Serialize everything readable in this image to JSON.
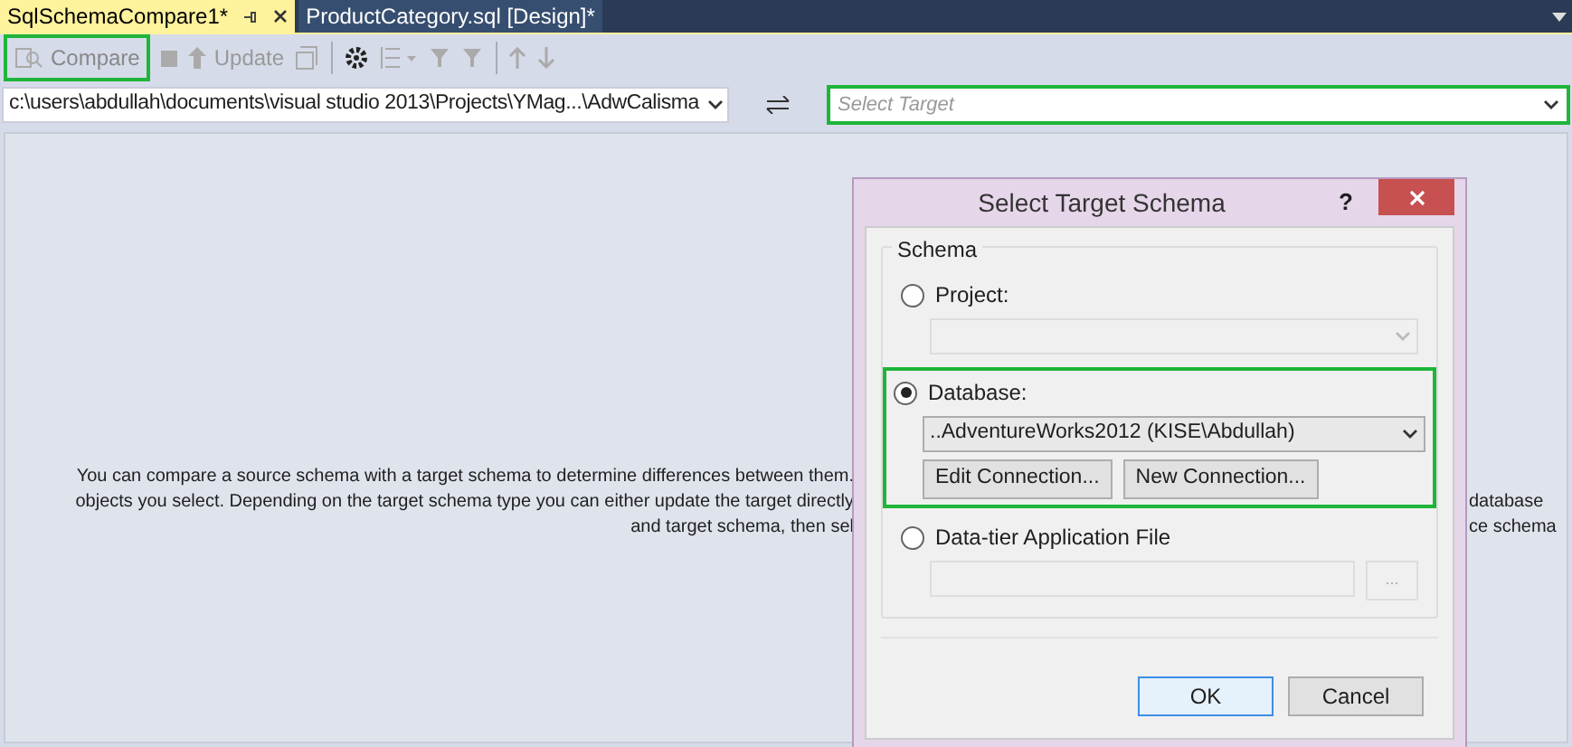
{
  "tabs": [
    {
      "label": "SqlSchemaCompare1*",
      "selected": true
    },
    {
      "label": "ProductCategory.sql [Design]*",
      "selected": false
    }
  ],
  "toolbar": {
    "compare": {
      "label": "Compare",
      "highlighted": true
    },
    "update": {
      "label": "Update"
    }
  },
  "source": {
    "value": "c:\\users\\abdullah\\documents\\visual studio 2013\\Projects\\YMag...\\AdwCalisma"
  },
  "target": {
    "placeholder": "Select Target",
    "highlighted": true
  },
  "message": {
    "left_lines": [
      "You can compare a source schema with a target schema to determine differences between them.",
      "objects you select.  Depending on the target schema type you can either update the target directly",
      "and target schema, then sel"
    ],
    "right_lines": [
      "database",
      "ce schema"
    ]
  },
  "dialog": {
    "title": "Select Target Schema",
    "help": "?",
    "group_label": "Schema",
    "options": [
      {
        "kind": "combo",
        "label": "Project:",
        "selected": false
      },
      {
        "kind": "combo",
        "label": "Database:",
        "selected": true,
        "value": "..AdventureWorks2012 (KISE\\Abdullah)",
        "highlighted": true,
        "buttons": [
          "Edit Connection...",
          "New Connection..."
        ]
      },
      {
        "kind": "file",
        "label": "Data-tier Application File",
        "selected": false,
        "browse": "..."
      }
    ],
    "ok": "OK",
    "cancel": "Cancel"
  }
}
